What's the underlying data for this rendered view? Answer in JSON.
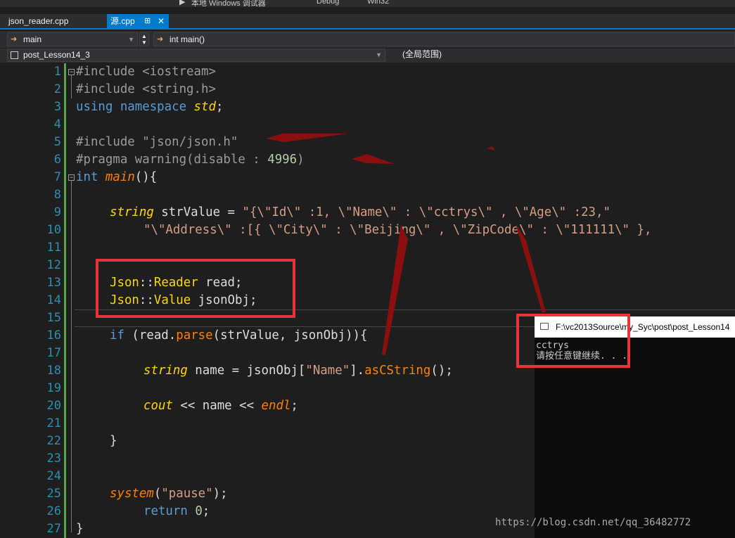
{
  "toolbar": {
    "run_label": "本地 Windows 调试器",
    "config": "Debug",
    "platform": "Win32"
  },
  "tabs": [
    {
      "label": "json_reader.cpp"
    },
    {
      "label": "源.cpp",
      "pin": "⊞",
      "close": "✕"
    }
  ],
  "nav": {
    "scope_combo": "main",
    "member_combo": "int main()"
  },
  "project": {
    "name": "post_Lesson14_3",
    "scope": "(全局范围)"
  },
  "code_lines": [
    {
      "n": "1"
    },
    {
      "n": "2"
    },
    {
      "n": "3"
    },
    {
      "n": "4"
    },
    {
      "n": "5"
    },
    {
      "n": "6"
    },
    {
      "n": "7"
    },
    {
      "n": "8"
    },
    {
      "n": "9"
    },
    {
      "n": "10"
    },
    {
      "n": "11"
    },
    {
      "n": "12"
    },
    {
      "n": "13"
    },
    {
      "n": "14"
    },
    {
      "n": "15"
    },
    {
      "n": "16"
    },
    {
      "n": "17"
    },
    {
      "n": "18"
    },
    {
      "n": "19"
    },
    {
      "n": "20"
    },
    {
      "n": "21"
    },
    {
      "n": "22"
    },
    {
      "n": "23"
    },
    {
      "n": "24"
    },
    {
      "n": "25"
    },
    {
      "n": "26"
    },
    {
      "n": "27"
    }
  ],
  "code": {
    "l1": "#include <iostream>",
    "l2": "#include <string.h>",
    "l3_using": "using namespace",
    "l3_std": "std",
    "l3_semi": ";",
    "l5": "#include \"json/json.h\"",
    "l6_a": "#pragma warning(disable : ",
    "l6_num": "4996",
    "l6_b": ")",
    "l7_int": "int",
    "l7_main": "main",
    "l7_rest": "(){",
    "l9_type": "string",
    "l9_var": " strValue = ",
    "l9_str": "\"{\\\"Id\\\" :1, \\\"Name\\\" : \\\"cctrys\\\" , \\\"Age\\\" :23,\"",
    "l10_str": "\"\\\"Address\\\" :[{ \\\"City\\\" : \\\"Beijing\\\" , \\\"ZipCode\\\" : \\\"111111\\\" },",
    "l13_ns": "Json",
    "l13_sep": "::",
    "l13_ty": "Reader",
    "l13_rest": " read;",
    "l14_ns": "Json",
    "l14_sep": "::",
    "l14_ty": "Value",
    "l14_rest": " jsonObj;",
    "l16_if": "if",
    "l16_a": " (read.",
    "l16_fn": "parse",
    "l16_b": "(strValue, jsonObj)){",
    "l18_type": "string",
    "l18_a": " name = jsonObj[",
    "l18_str": "\"Name\"",
    "l18_b": "].",
    "l18_fn": "asCString",
    "l18_c": "();",
    "l20_cout": "cout",
    "l20_a": " << name << ",
    "l20_endl": "endl",
    "l20_semi": ";",
    "l22": "}",
    "l25_fn": "system",
    "l25_a": "(",
    "l25_str": "\"pause\"",
    "l25_b": ");",
    "l26_ret": "return",
    "l26_sp": " ",
    "l26_num": "0",
    "l26_semi": ";",
    "l27": "}"
  },
  "console": {
    "title": "F:\\vc2013Source\\my_Syc\\post\\post_Lesson14",
    "line1": "cctrys",
    "line2": "请按任意键继续. . ."
  },
  "watermark": "https://blog.csdn.net/qq_36482772",
  "colors": {
    "annotation_red": "#e8333a",
    "arrow_red": "#8b0f0f",
    "line_numbers": "#2b91af",
    "keyword": "#569cd6"
  }
}
